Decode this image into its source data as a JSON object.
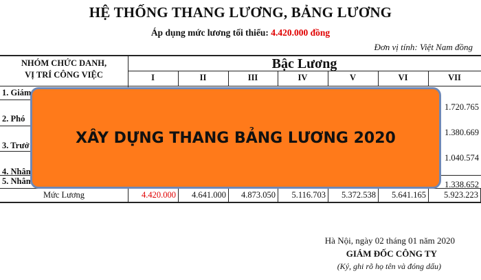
{
  "title": "HỆ THỐNG THANG LƯƠNG, BẢNG LƯƠNG",
  "subtitle_prefix": "Áp dụng mức lương tối thiểu: ",
  "subtitle_value": "4.420.000 đồng",
  "unit_note": "Đơn vị tính: Việt Nam đồng",
  "table": {
    "left_header_line1": "NHÓM CHỨC DANH,",
    "left_header_line2": "VỊ TRÍ CÔNG VIỆC",
    "salary_header": "Bậc Lương",
    "grades": [
      "I",
      "II",
      "III",
      "IV",
      "V",
      "VI",
      "VII"
    ],
    "rows": [
      {
        "label": "1. Giám",
        "vii_value": "1.720.765"
      },
      {
        "label": "2. Phó",
        "vii_value": "1.380.669"
      },
      {
        "label": "3. Trưở",
        "vii_value": "1.040.574"
      },
      {
        "label": "4. Nhân",
        "vii_value": "1.338.652"
      },
      {
        "label": "5. Nhân viên lao công, tạp vụ:"
      }
    ],
    "muc_luong_label": "Mức Lương",
    "muc_luong_values": [
      "4.420.000",
      "4.641.000",
      "4.873.050",
      "5.116.703",
      "5.372.538",
      "5.641.165",
      "5.923.223"
    ]
  },
  "overlay_text": "XÂY DỰNG THANG BẢNG LƯƠNG 2020",
  "footer": {
    "place_date": "Hà Nội, ngày 02 tháng 01 năm 2020",
    "director": "GIÁM ĐỐC CÔNG TY",
    "sign_note": "(Ký, ghi rõ họ tên và đóng dấu)"
  },
  "colors": {
    "accent_red": "#e00000",
    "overlay_fill": "#ff7a1a",
    "overlay_border": "#6f88b6"
  }
}
